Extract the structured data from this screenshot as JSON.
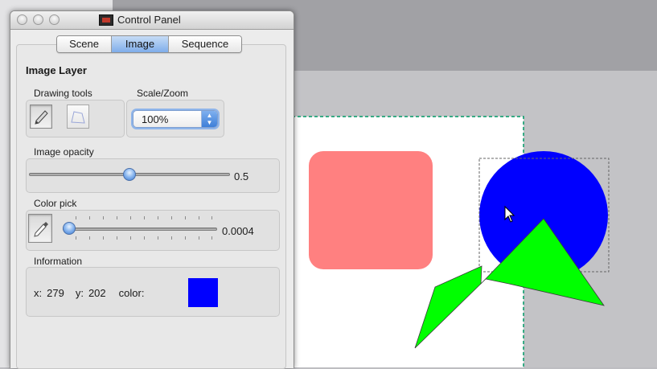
{
  "window": {
    "title": "Control Panel"
  },
  "tabs": [
    {
      "label": "Scene",
      "active": false
    },
    {
      "label": "Image",
      "active": true
    },
    {
      "label": "Sequence",
      "active": false
    }
  ],
  "image_layer": {
    "heading": "Image Layer",
    "drawing_tools": {
      "label": "Drawing tools",
      "tools": [
        {
          "icon": "pencil-icon",
          "pressed": true
        },
        {
          "icon": "polygon-icon",
          "pressed": false
        }
      ]
    },
    "scale_zoom": {
      "label": "Scale/Zoom",
      "value": "100%"
    },
    "image_opacity": {
      "label": "Image opacity",
      "value": "0.5",
      "fraction": 0.5
    },
    "color_pick": {
      "label": "Color pick",
      "value": "0.0004",
      "fraction": 0.0004,
      "icon": "eyedropper-icon"
    },
    "information": {
      "label": "Information",
      "x_label": "x:",
      "x_value": "279",
      "y_label": "y:",
      "y_value": "202",
      "color_label": "color:",
      "color_value": "#0000ff"
    }
  },
  "canvas": {
    "background": "#ffffff",
    "shapes": [
      {
        "name": "rounded-rectangle",
        "fill": "#ff8080"
      },
      {
        "name": "circle",
        "fill": "#0000ff"
      },
      {
        "name": "polygon",
        "fill": "#00ff00"
      }
    ],
    "selection_color": "#009966"
  }
}
